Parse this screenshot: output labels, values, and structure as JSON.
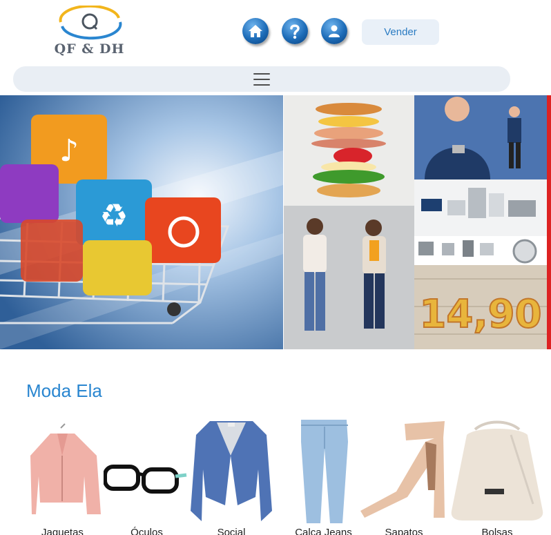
{
  "header": {
    "logo_text": "QF & DH",
    "logo_icon": "q-orbit-logo",
    "nav_icons": [
      "home-icon",
      "help-icon",
      "user-icon"
    ],
    "sell_button": "Vender"
  },
  "menu": {
    "icon": "hamburger-menu-icon"
  },
  "banner": {
    "tiles": [
      "shopping-cart-with-app-cubes",
      "burger-ingredients",
      "man-with-phone",
      "home-appliances",
      "women-fashion-models",
      "price-14-90"
    ],
    "price_text": "14,90"
  },
  "section": {
    "title": "Moda Ela",
    "products": [
      {
        "label": "Jaquetas",
        "icon": "pink-jacket"
      },
      {
        "label": "Óculos",
        "icon": "glasses"
      },
      {
        "label": "Social",
        "icon": "blue-blazer"
      },
      {
        "label": "Calça Jeans",
        "icon": "jeans"
      },
      {
        "label": "Sapatos",
        "icon": "heel-sandal"
      },
      {
        "label": "Bolsas",
        "icon": "bucket-bag"
      }
    ]
  }
}
